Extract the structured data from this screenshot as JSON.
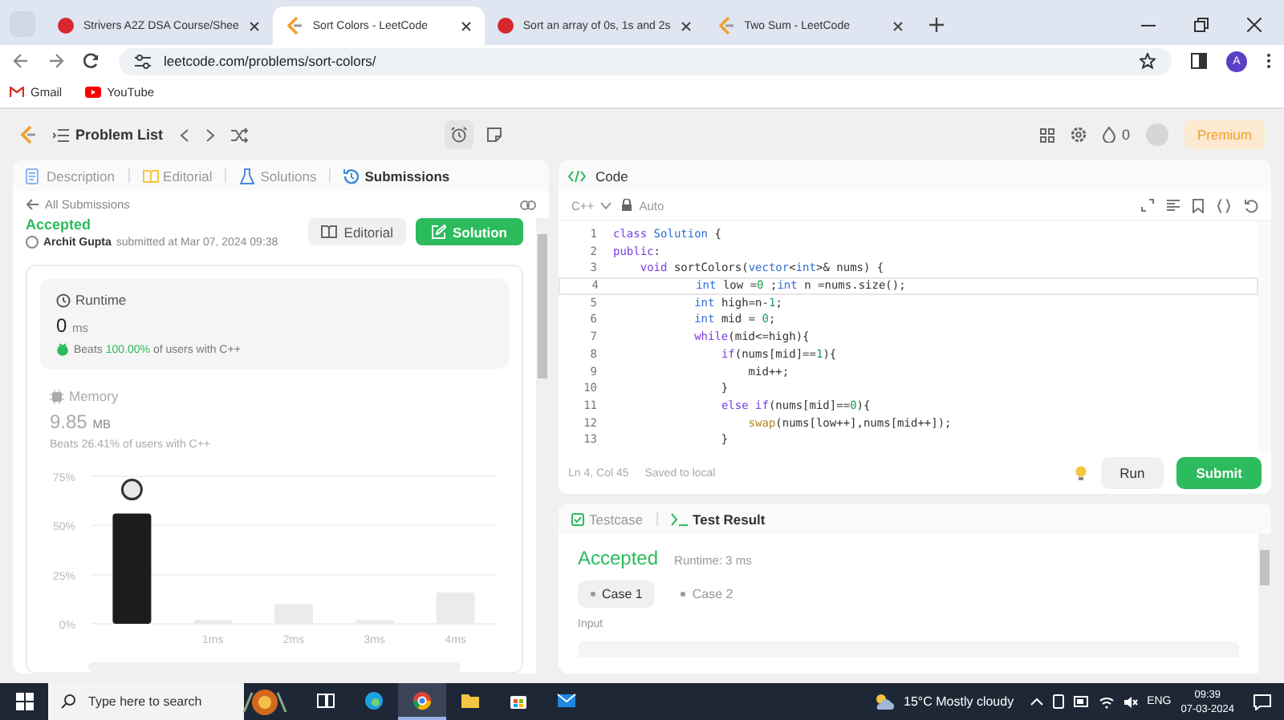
{
  "browser": {
    "tabs": [
      {
        "title": "Strivers A2Z DSA Course/Shee",
        "kind": "tuf",
        "selected": false
      },
      {
        "title": "Sort Colors - LeetCode",
        "kind": "leetcode",
        "selected": true
      },
      {
        "title": "Sort an array of 0s, 1s and 2s",
        "kind": "tuf",
        "selected": false
      },
      {
        "title": "Two Sum - LeetCode",
        "kind": "leetcode",
        "selected": false
      }
    ],
    "address": "leetcode.com/problems/sort-colors/",
    "profile_letter": "A",
    "bookmarks": [
      {
        "label": "Gmail",
        "kind": "gmail"
      },
      {
        "label": "YouTube",
        "kind": "youtube"
      }
    ]
  },
  "navbar": {
    "problem_list": "Problem List",
    "streak": "0",
    "premium": "Premium"
  },
  "left_panel": {
    "tabs": [
      {
        "label": "Description",
        "kind": "description",
        "selected": false
      },
      {
        "label": "Editorial",
        "kind": "editorial",
        "selected": false
      },
      {
        "label": "Solutions",
        "kind": "solutions",
        "selected": false
      },
      {
        "label": "Submissions",
        "kind": "submissions",
        "selected": true
      }
    ],
    "back_link": "All Submissions",
    "status": "Accepted",
    "author": "Archit Gupta",
    "submitted": "submitted at Mar 07, 2024 09:38",
    "buttons": [
      {
        "label": "Editorial",
        "kind": "plain"
      },
      {
        "label": "Solution",
        "kind": "primary"
      }
    ],
    "runtime": {
      "title": "Runtime",
      "value": "0",
      "unit": "ms",
      "beats_prefix": "Beats",
      "beats": "100.00%",
      "beats_suffix": "of users with C++"
    },
    "memory": {
      "title": "Memory",
      "value": "9.85",
      "unit": "MB",
      "beats_prefix": "Beats",
      "beats": "26.41%",
      "beats_suffix": "of users with C++"
    },
    "chart_data": {
      "type": "bar",
      "x": [
        0,
        1,
        2,
        3,
        4
      ],
      "xlim": [
        -0.5,
        4.5
      ],
      "xticks": [
        {
          "value": 1,
          "label": "1ms"
        },
        {
          "value": 2,
          "label": "2ms"
        },
        {
          "value": 3,
          "label": "3ms"
        },
        {
          "value": 4,
          "label": "4ms"
        }
      ],
      "ylim": [
        0,
        75
      ],
      "yticks": [
        {
          "value": 0,
          "label": "0%"
        },
        {
          "value": 25,
          "label": "25%"
        },
        {
          "value": 50,
          "label": "50%"
        },
        {
          "value": 75,
          "label": "75%"
        }
      ],
      "series": [
        {
          "color": "#1c1c1c",
          "values": [
            56,
            null,
            null,
            null,
            null
          ]
        },
        {
          "color": "#ebebeb",
          "values": [
            null,
            2,
            10,
            2,
            16
          ]
        }
      ]
    }
  },
  "code_panel": {
    "title": "Code",
    "language": "C++",
    "mode": "Auto",
    "lines": [
      {
        "number": "1",
        "text": "class Solution {",
        "current": false
      },
      {
        "number": "2",
        "text": "public:",
        "current": false
      },
      {
        "number": "3",
        "text": "    void sortColors(vector<int>& nums) {",
        "current": false
      },
      {
        "number": "4",
        "text": "            int low =0 ;int n =nums.size();",
        "current": true
      },
      {
        "number": "5",
        "text": "            int high=n-1;",
        "current": false
      },
      {
        "number": "6",
        "text": "            int mid = 0;",
        "current": false
      },
      {
        "number": "7",
        "text": "            while(mid<=high){",
        "current": false
      },
      {
        "number": "8",
        "text": "                if(nums[mid]==1){",
        "current": false
      },
      {
        "number": "9",
        "text": "                    mid++;",
        "current": false
      },
      {
        "number": "10",
        "text": "                }",
        "current": false
      },
      {
        "number": "11",
        "text": "                else if(nums[mid]==0){",
        "current": false
      },
      {
        "number": "12",
        "text": "                    swap(nums[low++],nums[mid++]);",
        "current": false
      },
      {
        "number": "13",
        "text": "                }",
        "current": false
      }
    ],
    "cursor": "Ln 4, Col 45",
    "save_status": "Saved to local",
    "run": "Run",
    "submit": "Submit"
  },
  "result_panel": {
    "tabs": [
      {
        "label": "Testcase",
        "kind": "testcase",
        "selected": false
      },
      {
        "label": "Test Result",
        "kind": "result",
        "selected": true
      }
    ],
    "status": "Accepted",
    "runtime": "Runtime: 3 ms",
    "cases": [
      {
        "label": "Case 1",
        "selected": true
      },
      {
        "label": "Case 2",
        "selected": false
      }
    ],
    "input_label": "Input"
  },
  "taskbar": {
    "search_placeholder": "Type here to search",
    "apps": [
      {
        "kind": "taskview",
        "selected": false
      },
      {
        "kind": "edge",
        "selected": false
      },
      {
        "kind": "chrome",
        "selected": true
      },
      {
        "kind": "explorer",
        "selected": false
      },
      {
        "kind": "store",
        "selected": false
      },
      {
        "kind": "mail",
        "selected": false
      }
    ],
    "weather": "15°C Mostly cloudy",
    "language": "ENG",
    "time": "09:39",
    "date": "07-03-2024"
  }
}
